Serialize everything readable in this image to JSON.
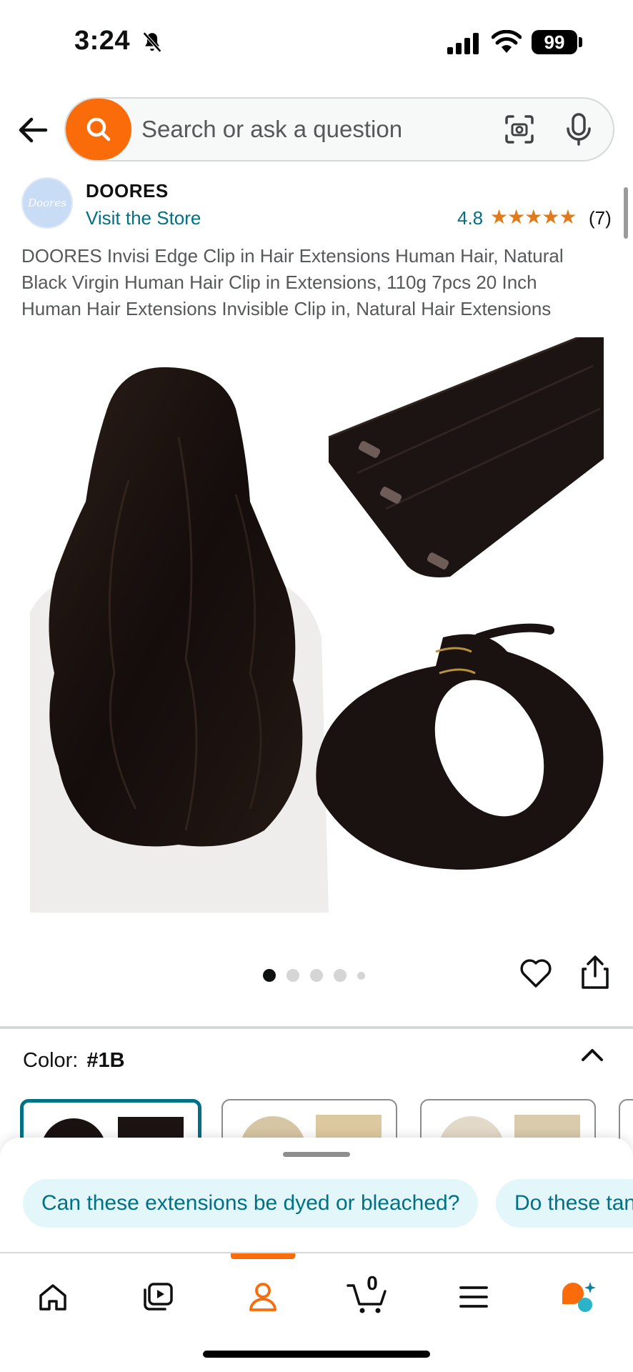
{
  "status_bar": {
    "time": "3:24",
    "battery": "99",
    "icons": [
      "bell-slash-icon",
      "signal-icon",
      "wifi-icon"
    ]
  },
  "header": {
    "back_icon": "arrow-left-icon",
    "search_icon": "search-icon",
    "search_placeholder": "Search or ask a question",
    "camera_icon": "camera-scan-icon",
    "mic_icon": "microphone-icon"
  },
  "brand": {
    "logo_text": "Doores",
    "name": "DOORES",
    "visit_store": "Visit the Store",
    "rating": "4.8",
    "stars": "★★★★★",
    "review_count": "(7)"
  },
  "product": {
    "title": "DOORES Invisi Edge Clip in Hair Extensions Human Hair, Natural Black Virgin Human Hair Clip in Extensions, 110g 7pcs 20 Inch Human Hair Extensions Invisible Clip in, Natural Hair Extensions",
    "image_count": 5,
    "active_image": 1
  },
  "variation": {
    "label": "Color:",
    "value": "#1B",
    "swatches": [
      "#1B",
      "blonde",
      "ash-blonde",
      "more"
    ]
  },
  "questions": {
    "chips": [
      "Can these extensions be dyed or bleached?",
      "Do these tan"
    ]
  },
  "tab_bar": {
    "items": [
      "home-icon",
      "play-video-icon",
      "account-icon",
      "cart-icon",
      "menu-icon",
      "rufus-assistant-icon"
    ],
    "active": 2,
    "cart_count": "0"
  },
  "colors": {
    "accent_orange": "#fa6b0a",
    "link_teal": "#007185",
    "star_orange": "#e07a1a",
    "chip_bg": "#e3f6fa"
  }
}
